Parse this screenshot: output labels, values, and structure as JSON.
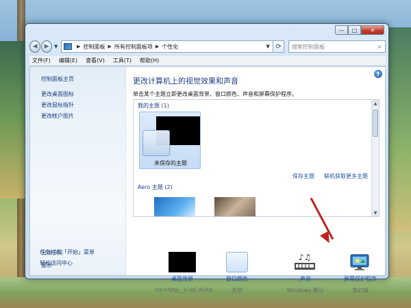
{
  "window": {
    "controls": {
      "minimize": "—",
      "maximize": "□",
      "close": "✕"
    }
  },
  "address_bar": {
    "back_glyph": "◀",
    "forward_glyph": "▶",
    "breadcrumbs": [
      "控制面板",
      "所有控制面板项",
      "个性化"
    ],
    "search_placeholder": "搜索控制面板"
  },
  "menubar": {
    "items": [
      "文件(F)",
      "编辑(E)",
      "查看(V)",
      "工具(T)",
      "帮助(H)"
    ]
  },
  "left_pane": {
    "links": [
      "控制面板主页",
      "更改桌面图标",
      "更改鼠标指针",
      "更改帐户图片"
    ],
    "see_also_title": "另请参阅",
    "see_also": [
      "显示",
      "任务栏和「开始」菜单",
      "轻松访问中心"
    ]
  },
  "main": {
    "title": "更改计算机上的视觉效果和声音",
    "subtitle": "单击某个主题立即更改桌面背景、窗口颜色、声音和屏幕保护程序。",
    "my_themes_label": "我的主题 (1)",
    "unsaved_theme": "未保存的主题",
    "save_theme": "保存主题",
    "get_more_themes": "联机获取更多主题",
    "aero_label": "Aero 主题 (2)"
  },
  "options": [
    {
      "label": "桌面背景",
      "value": "src=http__c-ssl.duita..."
    },
    {
      "label": "窗口颜色",
      "value": "天空"
    },
    {
      "label": "声音",
      "value": "Windows 默认"
    },
    {
      "label": "屏幕保护程序",
      "value": "变幻线"
    }
  ],
  "colors": {
    "link": "#1e4f9a",
    "title": "#1e3f8a",
    "annotation_arrow": "#c0211f"
  }
}
